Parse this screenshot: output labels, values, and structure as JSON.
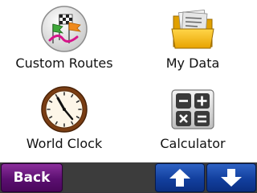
{
  "menu": {
    "items": [
      {
        "label": "Custom Routes",
        "icon": "route-flags-icon"
      },
      {
        "label": "My Data",
        "icon": "folder-icon"
      },
      {
        "label": "World Clock",
        "icon": "clock-icon"
      },
      {
        "label": "Calculator",
        "icon": "calculator-icon"
      }
    ]
  },
  "toolbar": {
    "back_label": "Back",
    "up_icon": "arrow-up-icon",
    "down_icon": "arrow-down-icon",
    "back_color": "#5b0f70",
    "arrow_color": "#123f9e"
  }
}
